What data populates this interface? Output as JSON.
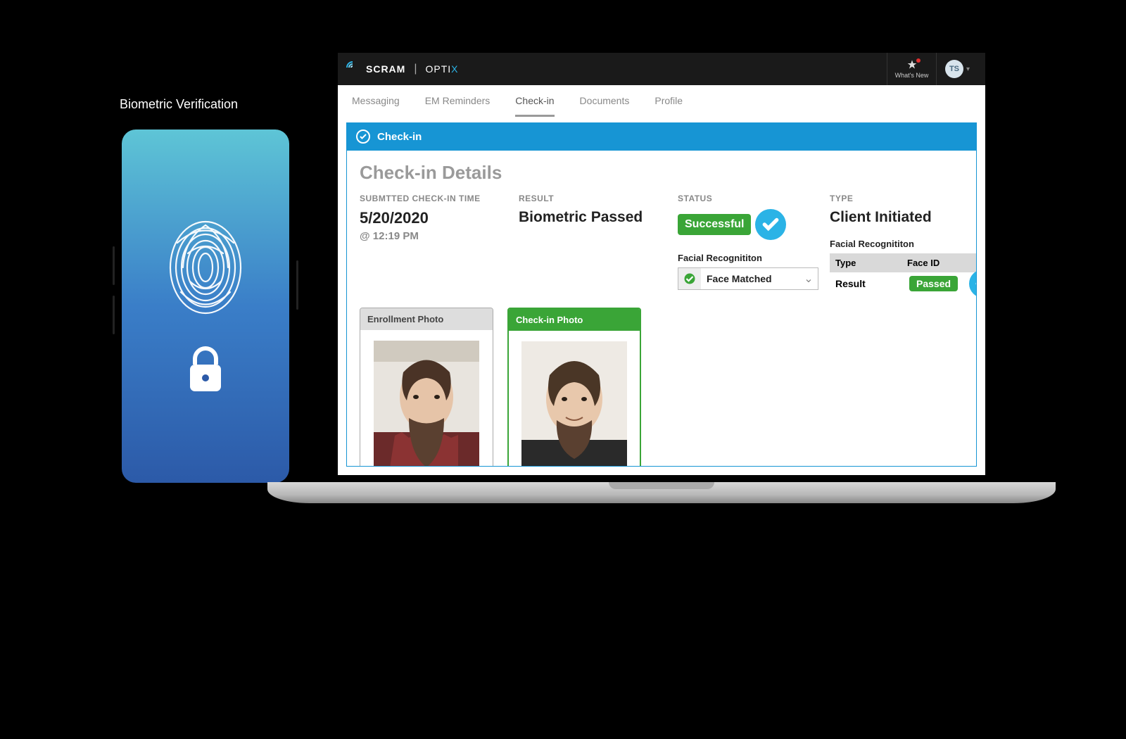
{
  "phone": {
    "label": "Biometric Verification"
  },
  "topbar": {
    "brand": "SCRAM",
    "product_prefix": "OPTI",
    "product_accent": "X",
    "whats_new": "What's New",
    "avatar_initials": "TS"
  },
  "tabs": [
    {
      "label": "Messaging",
      "active": false
    },
    {
      "label": "EM Reminders",
      "active": false
    },
    {
      "label": "Check-in",
      "active": true
    },
    {
      "label": "Documents",
      "active": false
    },
    {
      "label": "Profile",
      "active": false
    }
  ],
  "panel": {
    "title": "Check-in"
  },
  "details": {
    "heading": "Check-in Details",
    "submitted_label": "SUBMTTED CHECK-IN TIME",
    "submitted_date": "5/20/2020",
    "submitted_time": "@ 12:19 PM",
    "result_label": "RESULT",
    "result_value": "Biometric Passed",
    "status_label": "STATUS",
    "status_value": "Successful",
    "type_label": "TYPE",
    "type_value": "Client Initiated",
    "facial_rec_label": "Facial Recognititon",
    "face_match_value": "Face Matched",
    "recog_table": {
      "type_header": "Type",
      "type_value_header": "Face ID",
      "result_label": "Result",
      "result_value": "Passed"
    },
    "enrollment_photo_label": "Enrollment Photo",
    "checkin_photo_label": "Check-in Photo"
  }
}
